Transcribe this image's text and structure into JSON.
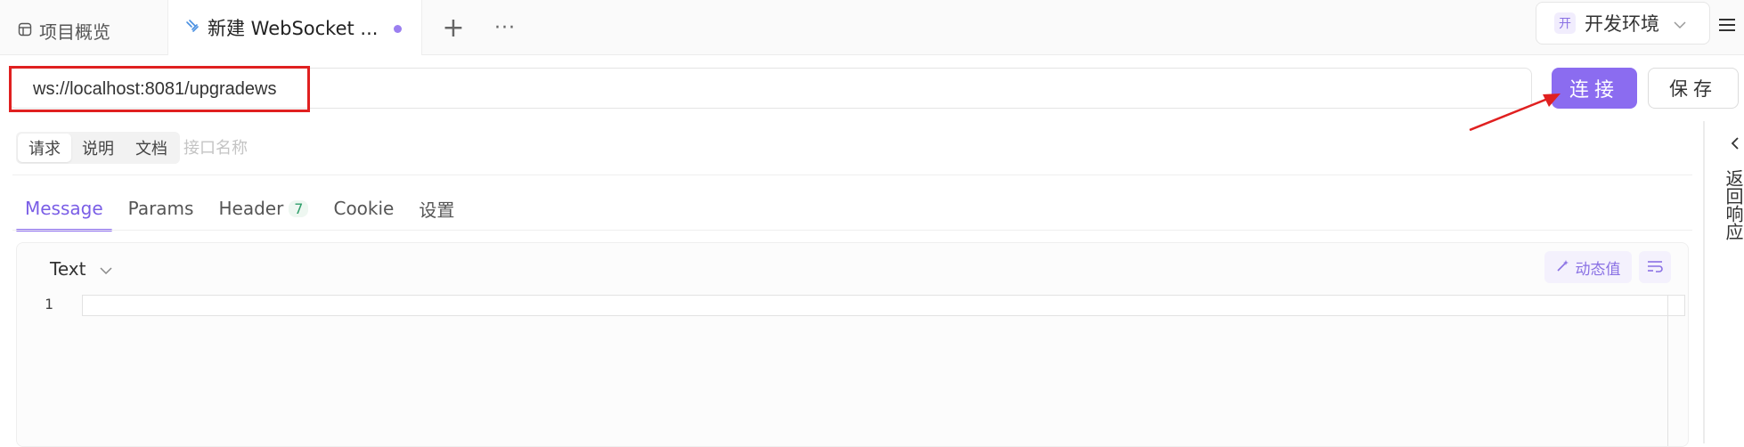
{
  "tabs": {
    "overview_label": "项目概览",
    "active_label": "新建 WebSocket ...",
    "add_symbol": "+",
    "more_symbol": "···"
  },
  "environment": {
    "badge": "开",
    "label": "开发环境"
  },
  "request": {
    "url": "ws://localhost:8081/upgradews",
    "connect_label": "连接",
    "save_label": "保存"
  },
  "sub_tabs": [
    {
      "label": "请求",
      "active": true
    },
    {
      "label": "说明",
      "active": false
    },
    {
      "label": "文档",
      "active": false
    }
  ],
  "api_name_placeholder": "接口名称",
  "request_tabs": [
    {
      "label": "Message",
      "active": true
    },
    {
      "label": "Params",
      "active": false
    },
    {
      "label": "Header",
      "count": "7",
      "active": false
    },
    {
      "label": "Cookie",
      "active": false
    },
    {
      "label": "设置",
      "active": false
    }
  ],
  "editor": {
    "type_label": "Text",
    "dynamic_value_label": "动态值",
    "line_numbers": [
      "1"
    ]
  },
  "response_panel": {
    "label": "返回响应"
  },
  "colors": {
    "accent": "#8b6cf0",
    "highlight_red": "#e02020",
    "tab_dot": "#9b7ff0"
  }
}
